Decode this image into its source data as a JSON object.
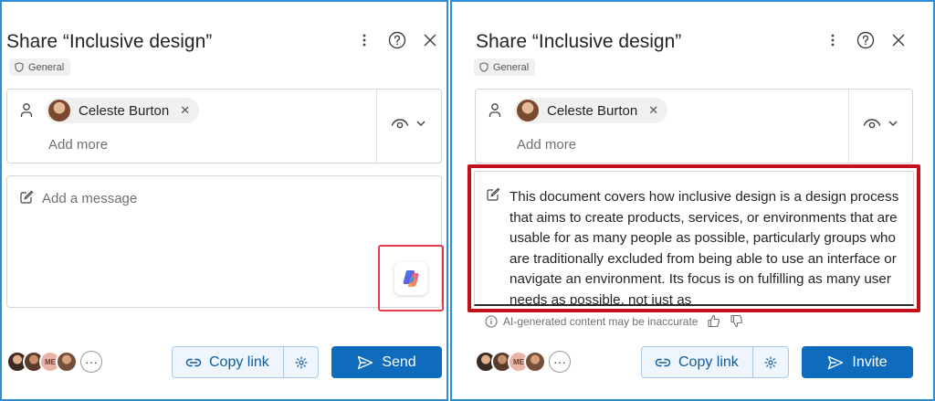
{
  "left": {
    "title": "Share “Inclusive design”",
    "sensitivity_label": "General",
    "recipient": {
      "name": "Celeste Burton",
      "remove_glyph": "✕"
    },
    "add_more_placeholder": "Add more",
    "message_placeholder": "Add a message",
    "people_more": "···",
    "avatar_initials": "ME",
    "copy_link_label": "Copy link",
    "primary_label": "Send"
  },
  "right": {
    "title": "Share “Inclusive design”",
    "sensitivity_label": "General",
    "recipient": {
      "name": "Celeste Burton",
      "remove_glyph": "✕"
    },
    "add_more_placeholder": "Add more",
    "message_text": "This document covers how inclusive design is a design process that aims to create products, services, or environments that are usable for as many people as possible, particularly groups who are traditionally excluded from being able to use an interface or navigate an environment. Its focus is on fulfilling as many user needs as possible, not just as",
    "ai_disclaimer": "AI-generated content may be inaccurate",
    "people_more": "···",
    "avatar_initials": "ME",
    "copy_link_label": "Copy link",
    "primary_label": "Invite"
  },
  "colors": {
    "panel_border": "#2b8ed6",
    "primary": "#0f6cbd",
    "highlight_left": "#e23b4a",
    "highlight_right": "#c2111d"
  },
  "icons": [
    "more-vertical-icon",
    "help-icon",
    "close-icon",
    "shield-icon",
    "person-icon",
    "eye-icon",
    "chevron-down-icon",
    "compose-icon",
    "copilot-icon",
    "info-icon",
    "thumbs-up-icon",
    "thumbs-down-icon",
    "link-icon",
    "gear-icon",
    "send-icon"
  ]
}
